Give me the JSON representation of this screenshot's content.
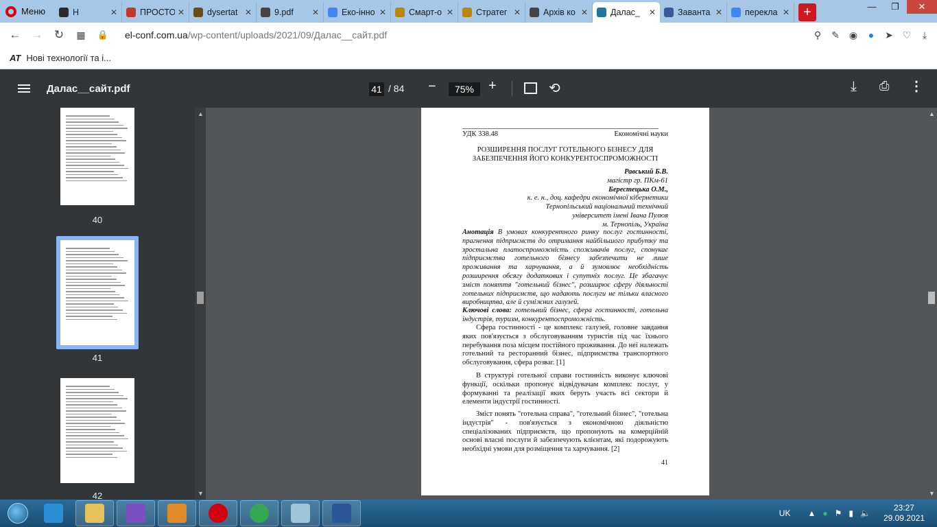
{
  "browser": {
    "menu_label": "Меню",
    "tabs": [
      {
        "label": "Н",
        "color": "#2b2b2b"
      },
      {
        "label": "ПРОСТО",
        "color": "#c0392b"
      },
      {
        "label": "dysertat",
        "color": "#6b4e16"
      },
      {
        "label": "9.pdf",
        "color": "#444444"
      },
      {
        "label": "Еко-інно",
        "color": "#4285f4"
      },
      {
        "label": "Смарт-о",
        "color": "#b8860b"
      },
      {
        "label": "Стратег",
        "color": "#b8860b"
      },
      {
        "label": "Архів ко",
        "color": "#444444"
      },
      {
        "label": "Далас_",
        "color": "#21759b",
        "active": true
      },
      {
        "label": "Заванта",
        "color": "#3b5998"
      },
      {
        "label": "перекла",
        "color": "#4285f4"
      }
    ],
    "new_tab_label": "+",
    "url_domain": "el-conf.com.ua",
    "url_path": "/wp-content/uploads/2021/09/Далас__сайт.pdf",
    "bookmark_icon": "AT",
    "bookmark_label": "Нові технології та і..."
  },
  "pdf": {
    "file_title": "Далас__сайт.pdf",
    "current_page": "41",
    "total_pages": "/ 84",
    "zoom": "75%",
    "zoom_minus": "−",
    "zoom_plus": "+"
  },
  "sidebar": {
    "thumbnails": [
      {
        "label": "40"
      },
      {
        "label": "41",
        "selected": true
      },
      {
        "label": "42"
      }
    ]
  },
  "document": {
    "udk": "УДК 338.48",
    "section": "Економічні науки",
    "title_line1": "РОЗШИРЕННЯ ПОСЛУГ ГОТЕЛЬНОГО БІЗНЕСУ ДЛЯ",
    "title_line2": "ЗАБЕЗПЕЧЕННЯ ЙОГО КОНКУРЕНТОСПРОМОЖНОСТІ",
    "author1": "Равський Б.В.",
    "author1_role": "магістр гр. ПКм-61",
    "author2": "Берестецька О.М.,",
    "author2_role": "к. е. н., доц. кафедри економічної кібернетики",
    "univ_line1": "Тернопільський національний технічний",
    "univ_line2": "університет імені Івана Пулюя",
    "city": "м. Тернопіль, Україна",
    "abstract_label": "Анотація",
    "abstract": " В умовах конкурентного ринку послуг гостинності, прагнення підприємств до отримання найбільшого прибутку та зростальна платоспроможність споживачів послуг, спонукає підприємства готельного бізнесу забезпечити не лише проживання та харчування, а й зумовлює необхідність розширення обсягу додаткових і супутніх послуг. Це збагачує зміст поняття \"готельний бізнес\", розширює сферу діяльності готельних підприємств, що надають послуги не тільки власного виробництва, але й суміжних галузей.",
    "keywords_label": "Ключові слова:",
    "keywords": " готельний бізнес, сфера гостинності, готельна індустрія, туризм, конкурентоспроможність.",
    "para1": "Сфера гостинності - це комплекс галузей, головне завдання яких пов'язується з обслуговуванням туристів під час їхнього перебування поза місцем постійного проживання. До неї належать готельний та ресторанний бізнес, підприємства транспортного обслуговування, сфера розваг. [1]",
    "para2": "В структурі готельної справи гостинність виконує ключові функції, оскільки пропонує відвідувачам комплекс послуг, у формуванні та реалізації яких беруть участь всі сектори й елементи індустрії гостинності.",
    "para3": "Зміст понять \"готельна справа\", \"готельний бізнес\", \"готельна індустрія\" - пов'язується з економічною діяльністю спеціалізованих підприємств, що пропонують на комерційній основі власні послуги й забезпечують клієнтам, які подорожують необхідні умови для розміщення та харчування. [2]",
    "page_number": "41"
  },
  "taskbar": {
    "apps": [
      {
        "name": "ie",
        "color": "#2a8fd6"
      },
      {
        "name": "explorer",
        "color": "#e6c15a"
      },
      {
        "name": "visual-studio",
        "color": "#7a4fc2"
      },
      {
        "name": "media-player",
        "color": "#e08a2a"
      },
      {
        "name": "opera",
        "color": "#d3000f"
      },
      {
        "name": "chrome",
        "color": "#34a853"
      },
      {
        "name": "notepad",
        "color": "#9fc5d8"
      },
      {
        "name": "word",
        "color": "#2b579a"
      }
    ],
    "language": "UK",
    "time": "23:27",
    "date": "29.09.2021"
  }
}
